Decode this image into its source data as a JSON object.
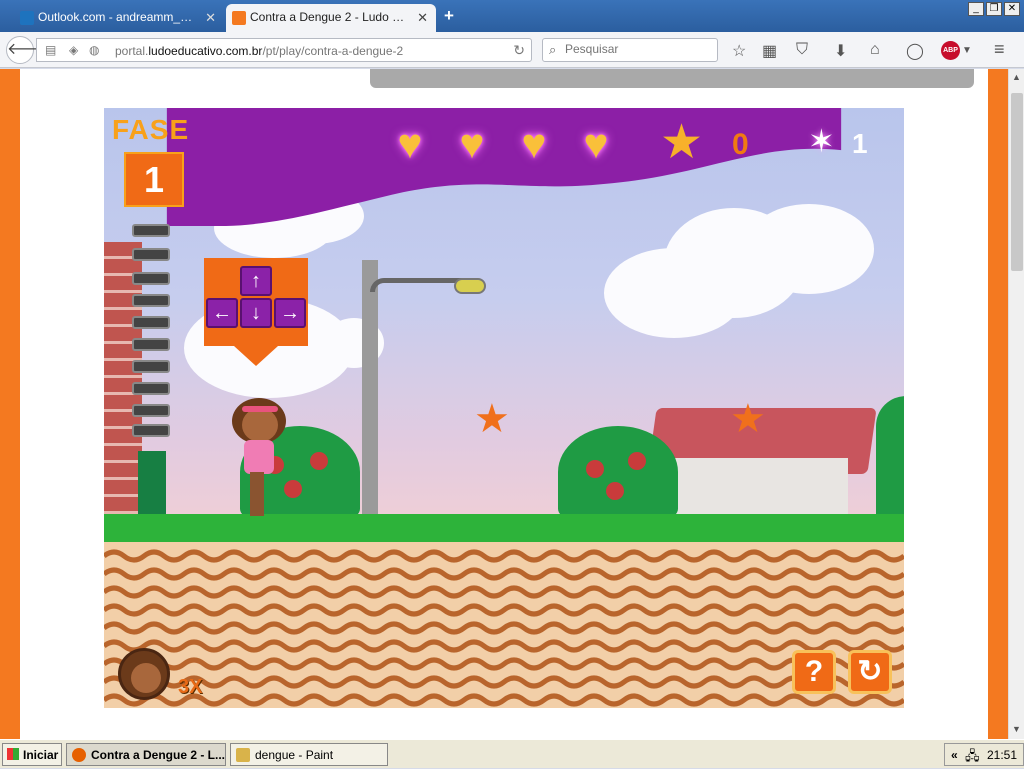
{
  "browser": {
    "tabs": [
      {
        "title": "Outlook.com - andreamm_10...",
        "icon": "outlook-icon",
        "color": "#1e73be"
      },
      {
        "title": "Contra a Dengue 2 - Ludo Ed...",
        "icon": "ludo-icon",
        "color": "#f47920"
      }
    ],
    "new_tab_label": "+",
    "url_prefix": "portal.",
    "url_domain": "ludoeducativo.com.br",
    "url_path": "/pt/play/contra-a-dengue-2",
    "search_placeholder": "Pesquisar",
    "abp_label": "ABP",
    "window_buttons": [
      "_",
      "❐",
      "✕"
    ]
  },
  "site": {
    "accent_color": "#f47920"
  },
  "game": {
    "phase_label": "FASE",
    "phase_number": "1",
    "hearts": 4,
    "stars_collected": "0",
    "mosquitoes": "1",
    "lives": "3X",
    "arrow_keys": [
      "↑",
      "←",
      "↓",
      "→"
    ],
    "help_button": "?",
    "restart_button": "↻",
    "colors": {
      "hud_purple": "#8c1fa6",
      "hud_orange": "#f8a11a",
      "heart": "#f9c03a",
      "grass": "#2db33a"
    }
  },
  "taskbar": {
    "start_label": "Iniciar",
    "tasks": [
      {
        "label": "Contra a Dengue 2 - L...",
        "icon": "firefox-icon"
      },
      {
        "label": "dengue - Paint",
        "icon": "paint-icon"
      }
    ],
    "tray_chevron": "«",
    "time": "21:51"
  }
}
